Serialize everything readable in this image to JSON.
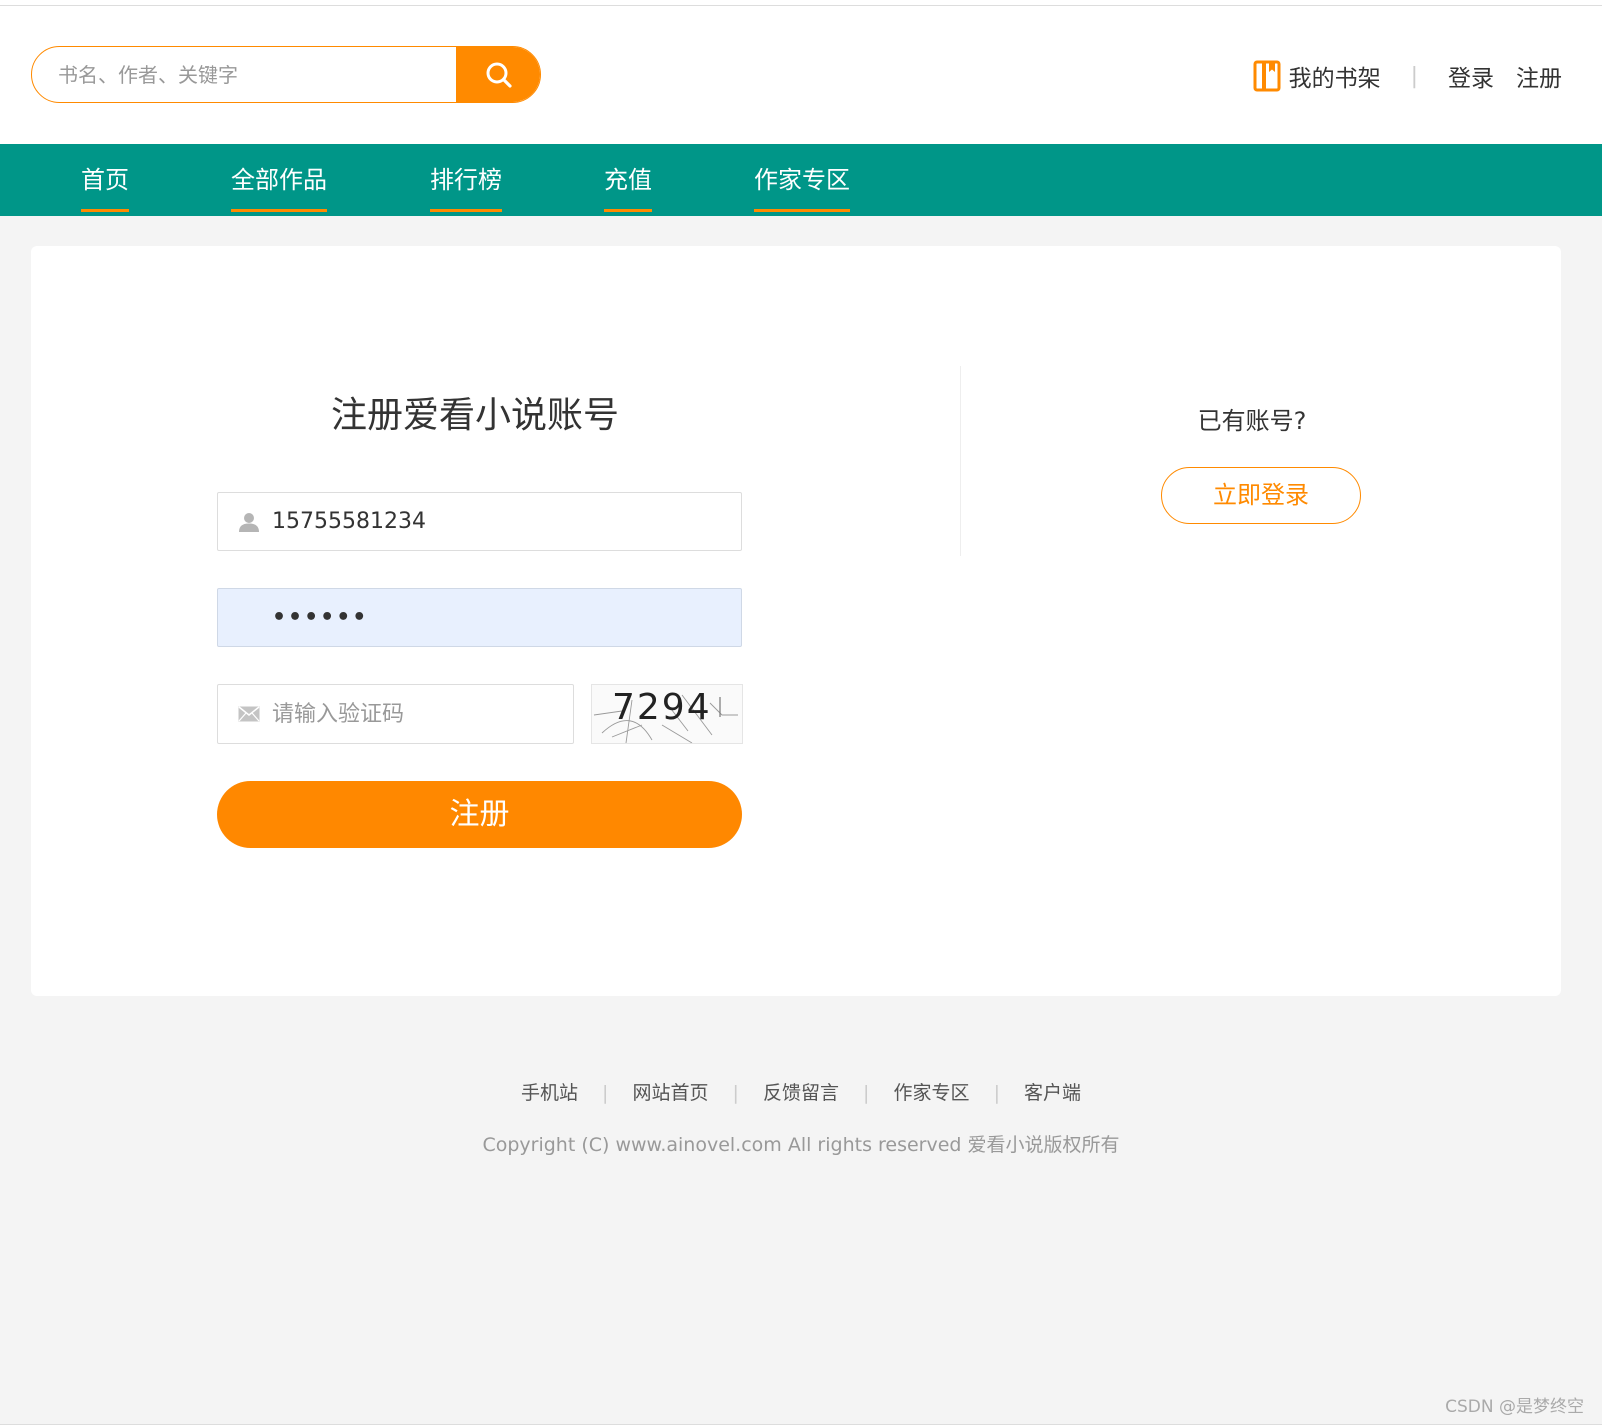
{
  "search": {
    "placeholder": "书名、作者、关键字"
  },
  "user_links": {
    "shelf": "我的书架",
    "separator": "|",
    "login": "登录",
    "register": "注册"
  },
  "nav": {
    "items": [
      "首页",
      "全部作品",
      "排行榜",
      "充值",
      "作家专区"
    ]
  },
  "register_form": {
    "title": "注册爱看小说账号",
    "username_value": "15755581234",
    "password_value": "••••••",
    "code_placeholder": "请输入验证码",
    "captcha_text": "7294",
    "submit_label": "注册"
  },
  "login_panel": {
    "prompt": "已有账号?",
    "button_label": "立即登录"
  },
  "footer": {
    "links": [
      "手机站",
      "网站首页",
      "反馈留言",
      "作家专区",
      "客户端"
    ],
    "separator": "|",
    "copyright": "Copyright (C) www.ainovel.com All rights reserved  爱看小说版权所有"
  },
  "watermark": "CSDN @是梦终空",
  "colors": {
    "accent": "#ff8a00",
    "nav_bg": "#009688",
    "page_bg": "#f4f4f4"
  }
}
